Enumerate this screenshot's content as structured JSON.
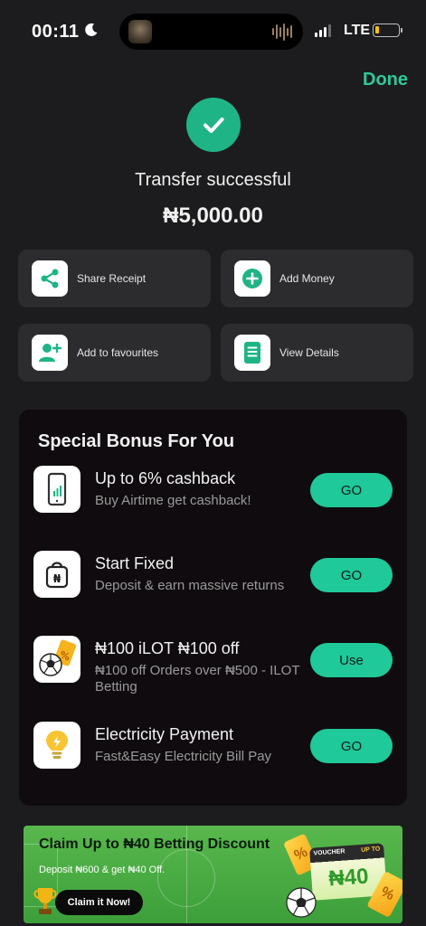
{
  "status_bar": {
    "time": "00:11",
    "network": "LTE",
    "battery_level_fraction": 0.15
  },
  "header": {
    "done_label": "Done",
    "status_title": "Transfer successful",
    "amount": "₦5,000.00"
  },
  "actions": [
    {
      "label": "Share Receipt",
      "icon": "share-icon"
    },
    {
      "label": "Add Money",
      "icon": "plus-circle-icon"
    },
    {
      "label": "Add to favourites",
      "icon": "add-user-icon"
    },
    {
      "label": "View Details",
      "icon": "list-icon"
    }
  ],
  "bonus": {
    "title": "Special Bonus For You",
    "items": [
      {
        "heading": "Up to 6% cashback",
        "sub": "Buy Airtime get cashback!",
        "button": "GO",
        "icon": "phone-icon"
      },
      {
        "heading": "Start Fixed",
        "sub": "Deposit & earn massive returns",
        "button": "GO",
        "icon": "naira-bag-icon"
      },
      {
        "heading": "₦100 iLOT ₦100 off",
        "sub": "₦100 off Orders over ₦500 - ILOT Betting",
        "button": "Use",
        "icon": "soccer-ticket-icon"
      },
      {
        "heading": "Electricity Payment",
        "sub": "Fast&Easy Electricity Bill Pay",
        "button": "GO",
        "icon": "lightbulb-icon"
      }
    ]
  },
  "banner": {
    "title": "Claim Up to ₦40 Betting Discount",
    "sub": "Deposit ₦600 & get ₦40 Off.",
    "button": "Claim it Now!",
    "voucher_tag": "VOUCHER",
    "voucher_upto": "UP TO",
    "voucher_amount": "₦40"
  },
  "colors": {
    "accent": "#1fc999",
    "background": "#1c1c1e",
    "panel": "#0f0b0e",
    "tile": "#2c2c2e"
  }
}
